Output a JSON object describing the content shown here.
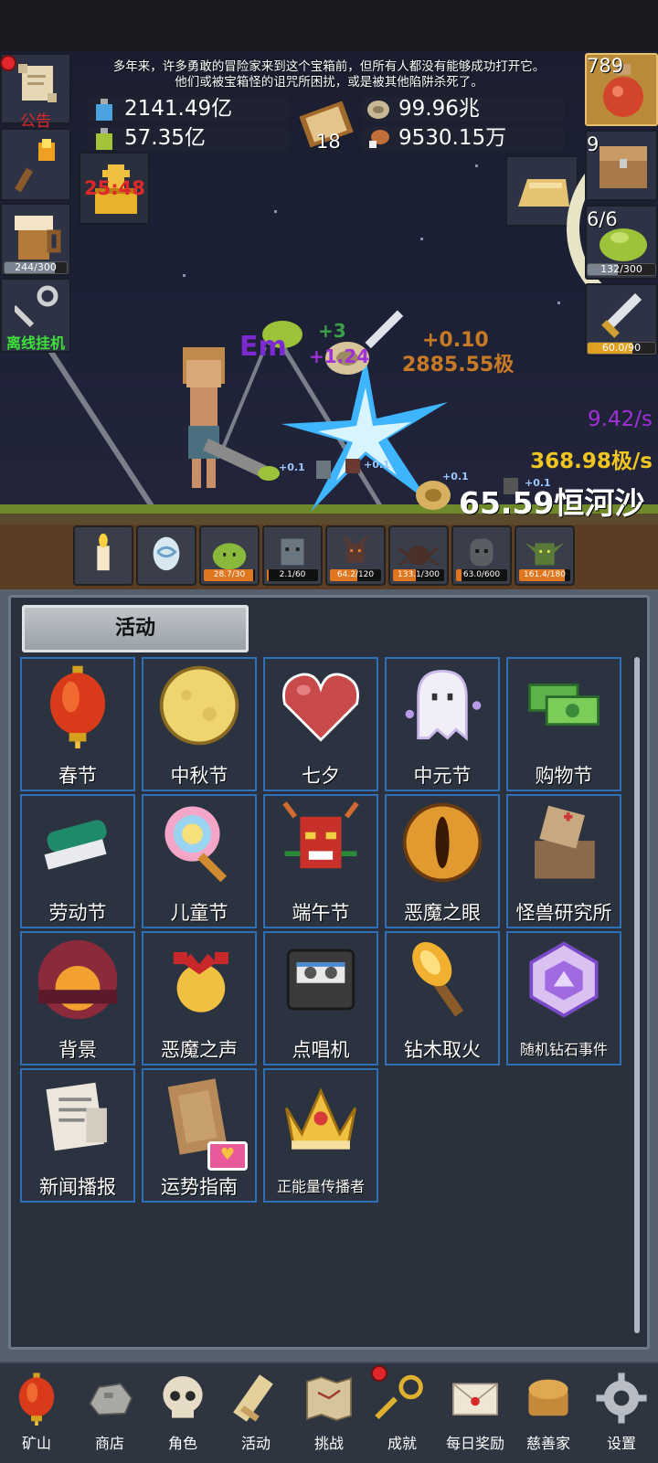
{
  "intro": {
    "line1": "多年来，许多勇敢的冒险家来到这个宝箱前，但所有人都没有能够成功打开它。",
    "line2": "他们或被宝箱怪的诅咒所困扰，或是被其他陷阱杀死了。"
  },
  "left_side": {
    "notice_label": "公告",
    "beer_progress": "244/300",
    "beer_fraction": 0.813,
    "offline_label": "离线挂机",
    "timer": "25:48"
  },
  "resources": {
    "blue_potion": "2141.49亿",
    "green_potion": "57.35亿",
    "book_count": "18",
    "coin": "99.96兆",
    "meat": "9530.15万"
  },
  "right_side": {
    "potion_count": "789",
    "chest_count": "9",
    "slime_count": "6/6",
    "slime_progress": "132/300",
    "slime_fraction": 0.44,
    "sword_progress": "60.0/90",
    "sword_fraction": 0.667
  },
  "battle": {
    "float_plus3": "+3",
    "float_purple": "+1.24",
    "float_orange": "+0.10",
    "float_damage": "2885.55极",
    "small_plus": "+0.1",
    "rate_purple": "9.42/s",
    "rate_gold": "368.98极/s",
    "coin_total": "65.59恒河沙",
    "boss_label": "Em"
  },
  "monsters": [
    {
      "name": "candle",
      "progress": ""
    },
    {
      "name": "egg",
      "progress": ""
    },
    {
      "name": "green-slime",
      "progress": "28.7/30",
      "fraction": 0.957
    },
    {
      "name": "zombie",
      "progress": "2.1/60",
      "fraction": 0.035
    },
    {
      "name": "bat",
      "progress": "64.2/120",
      "fraction": 0.535
    },
    {
      "name": "spider",
      "progress": "133.1/300",
      "fraction": 0.444
    },
    {
      "name": "ghost",
      "progress": "63.0/600",
      "fraction": 0.105
    },
    {
      "name": "goblin",
      "progress": "161.4/180",
      "fraction": 0.897
    }
  ],
  "panel": {
    "title": "活动",
    "cards": [
      {
        "label": "春节",
        "icon": "lantern-icon"
      },
      {
        "label": "中秋节",
        "icon": "moon-icon"
      },
      {
        "label": "七夕",
        "icon": "heart-icon"
      },
      {
        "label": "中元节",
        "icon": "ghost-icon"
      },
      {
        "label": "购物节",
        "icon": "money-icon"
      },
      {
        "label": "劳动节",
        "icon": "brush-icon"
      },
      {
        "label": "儿童节",
        "icon": "lollipop-icon"
      },
      {
        "label": "端午节",
        "icon": "dragon-mask-icon"
      },
      {
        "label": "恶魔之眼",
        "icon": "demon-eye-icon"
      },
      {
        "label": "怪兽研究所",
        "icon": "lab-crate-icon"
      },
      {
        "label": "背景",
        "icon": "sunset-icon"
      },
      {
        "label": "恶魔之声",
        "icon": "bell-icon"
      },
      {
        "label": "点唱机",
        "icon": "cassette-icon"
      },
      {
        "label": "钻木取火",
        "icon": "torch-stick-icon"
      },
      {
        "label": "随机钻石事件",
        "icon": "diamond-icon"
      },
      {
        "label": "新闻播报",
        "icon": "newspaper-icon"
      },
      {
        "label": "运势指南",
        "icon": "fortune-book-icon"
      },
      {
        "label": "正能量传播者",
        "icon": "crown-icon"
      }
    ]
  },
  "nav": [
    {
      "label": "矿山",
      "icon": "lantern-icon"
    },
    {
      "label": "商店",
      "icon": "ore-icon"
    },
    {
      "label": "角色",
      "icon": "skull-icon"
    },
    {
      "label": "活动",
      "icon": "scroll-icon"
    },
    {
      "label": "挑战",
      "icon": "map-icon"
    },
    {
      "label": "成就",
      "icon": "key-icon"
    },
    {
      "label": "每日奖励",
      "icon": "letter-icon"
    },
    {
      "label": "慈善家",
      "icon": "bread-icon"
    },
    {
      "label": "设置",
      "icon": "gear-icon"
    }
  ]
}
